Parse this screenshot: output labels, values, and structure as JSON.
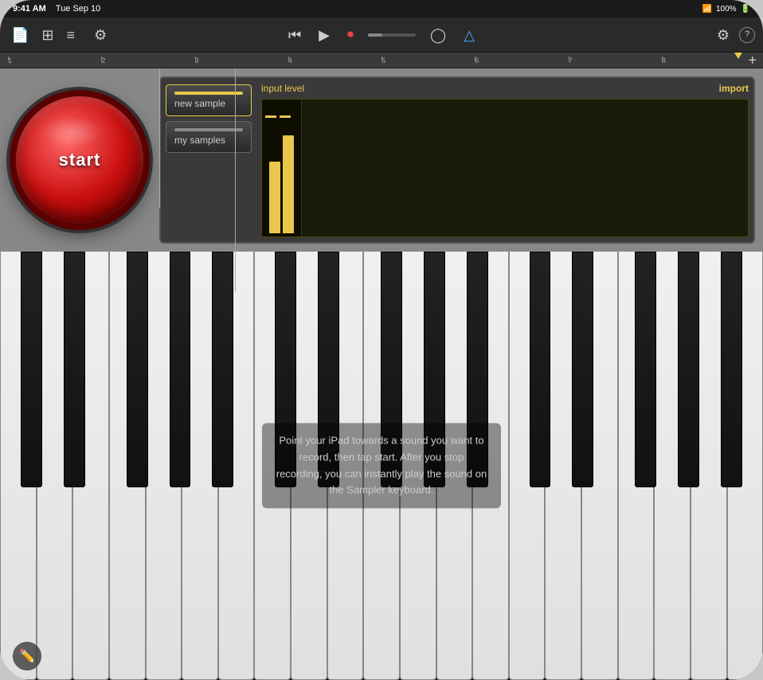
{
  "status": {
    "time": "9:41 AM",
    "date": "Tue Sep 10",
    "wifi": "100%"
  },
  "toolbar": {
    "buttons": {
      "new_song": "📄",
      "tracks": "⊞",
      "list": "≡",
      "mixer": "⚙"
    },
    "transport": {
      "rewind": "⏮",
      "play": "▶",
      "record": "⏺",
      "master": "◯",
      "metronome": "🎵"
    },
    "right": {
      "settings": "⚙",
      "help": "?"
    },
    "plus": "+"
  },
  "ruler": {
    "marks": [
      "1",
      "2",
      "3",
      "4",
      "5",
      "6",
      "7",
      "8"
    ]
  },
  "sampler": {
    "start_label": "start",
    "buttons": [
      {
        "id": "new-sample",
        "label": "new sample",
        "active": true
      },
      {
        "id": "my-samples",
        "label": "my samples",
        "active": false
      }
    ],
    "input_level_label": "input level",
    "import_label": "import"
  },
  "keyboard": {
    "instruction": "Point your iPad towards a sound you want to record, then tap start. After you stop recording, you can instantly play the sound on the Sampler keyboard."
  }
}
